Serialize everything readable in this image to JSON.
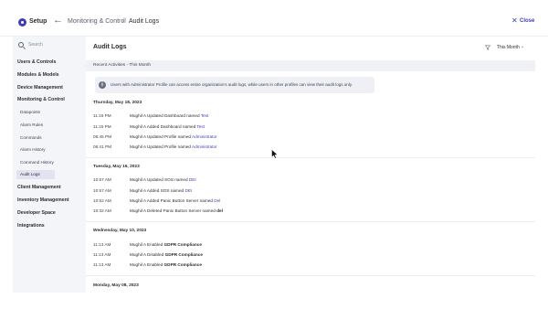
{
  "header": {
    "app_title": "Setup",
    "breadcrumb": [
      "Monitoring & Control",
      "/",
      "Audit Logs"
    ],
    "close_label": "Close",
    "icons": {
      "settings": "gear-icon",
      "back": "arrow-left-icon",
      "close": "close-icon"
    }
  },
  "sidebar": {
    "search_placeholder": "Search",
    "items": [
      {
        "label": "Users & Controls",
        "type": "section"
      },
      {
        "label": "Modules & Models",
        "type": "section"
      },
      {
        "label": "Device Management",
        "type": "section"
      },
      {
        "label": "Monitoring & Control",
        "type": "section",
        "expanded": true
      },
      {
        "label": "Datapoints",
        "type": "sub"
      },
      {
        "label": "Alarm Rules",
        "type": "sub"
      },
      {
        "label": "Commands",
        "type": "sub"
      },
      {
        "label": "Alarm History",
        "type": "sub"
      },
      {
        "label": "Command History",
        "type": "sub"
      },
      {
        "label": "Audit Logs",
        "type": "sub",
        "active": true
      },
      {
        "label": "Client Management",
        "type": "section"
      },
      {
        "label": "Inventory Management",
        "type": "section"
      },
      {
        "label": "Developer Space",
        "type": "section"
      },
      {
        "label": "Integrations",
        "type": "section"
      }
    ]
  },
  "main": {
    "title": "Audit Logs",
    "filter_icon": "filter-icon",
    "period": "This Month",
    "section_label": "Recent Activities - This Month",
    "info": "Users with Administrator Profile can access entire organization's audit logs, while users in other profiles can view their audit logs only.",
    "groups": [
      {
        "date": "Thursday, May 18, 2023",
        "rows": [
          {
            "time": "11:16 PM",
            "text": "Mughil A Updated Dashboard named ",
            "target": "Test",
            "style": "link"
          },
          {
            "time": "11:15 PM",
            "text": "Mughil A Added Dashboard named ",
            "target": "Test",
            "style": "link"
          },
          {
            "time": "06:45 PM",
            "text": "Mughil A Updated Profile named ",
            "target": "Administrator",
            "style": "link"
          },
          {
            "time": "06:41 PM",
            "text": "Mughil A Updated Profile named ",
            "target": "Administrator",
            "style": "link"
          }
        ]
      },
      {
        "date": "Tuesday, May 16, 2023",
        "rows": [
          {
            "time": "10:57 AM",
            "text": "Mughil A Updated SOS named ",
            "target": "DEI",
            "style": "link"
          },
          {
            "time": "10:57 AM",
            "text": "Mughil A Added SOS named ",
            "target": "DEI",
            "style": "link"
          },
          {
            "time": "10:52 AM",
            "text": "Mughil A Added Panic Button Server named ",
            "target": "Del",
            "style": "link"
          },
          {
            "time": "10:32 AM",
            "text": "Mughil A Deleted Panic Button Server named ",
            "target": "del",
            "style": "bold"
          }
        ]
      },
      {
        "date": "Wednesday, May 10, 2023",
        "rows": [
          {
            "time": "11:13 AM",
            "text": "Mughil A Enabled ",
            "target": "GDPR Compliance",
            "style": "bold"
          },
          {
            "time": "11:13 AM",
            "text": "Mughil A Disabled ",
            "target": "GDPR Compliance",
            "style": "bold"
          },
          {
            "time": "11:13 AM",
            "text": "Mughil A Enabled ",
            "target": "GDPR Compliance",
            "style": "bold"
          }
        ]
      },
      {
        "date": "Monday, May 08, 2023",
        "rows": []
      }
    ]
  },
  "colors": {
    "accent": "#3d3fb5",
    "sidebar_bg": "#f4f5f8",
    "active_bg": "#e2e3f0",
    "section_bg": "#eff1f5"
  }
}
